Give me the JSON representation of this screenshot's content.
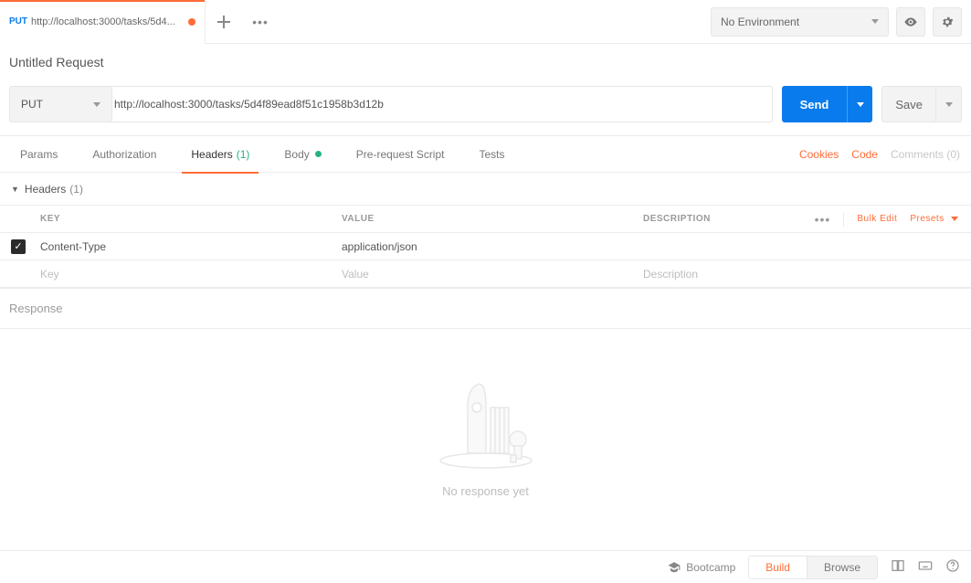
{
  "tab": {
    "method": "PUT",
    "title": "http://localhost:3000/tasks/5d4..."
  },
  "topbar": {
    "environment": "No Environment"
  },
  "request": {
    "name": "Untitled Request",
    "method": "PUT",
    "url": "http://localhost:3000/tasks/5d4f89ead8f51c1958b3d12b",
    "send_label": "Send",
    "save_label": "Save"
  },
  "request_tabs": {
    "params": "Params",
    "authorization": "Authorization",
    "headers": "Headers",
    "headers_count": "(1)",
    "body": "Body",
    "prerequest": "Pre-request Script",
    "tests": "Tests",
    "cookies": "Cookies",
    "code": "Code",
    "comments": "Comments (0)"
  },
  "headers_section": {
    "title": "Headers",
    "count": "(1)",
    "columns": {
      "key": "KEY",
      "value": "VALUE",
      "description": "DESCRIPTION"
    },
    "bulk_edit": "Bulk Edit",
    "presets": "Presets",
    "rows": [
      {
        "key": "Content-Type",
        "value": "application/json"
      }
    ],
    "placeholders": {
      "key": "Key",
      "value": "Value",
      "description": "Description"
    }
  },
  "response": {
    "label": "Response",
    "empty_text": "No response yet"
  },
  "footer": {
    "bootcamp": "Bootcamp",
    "build": "Build",
    "browse": "Browse"
  }
}
